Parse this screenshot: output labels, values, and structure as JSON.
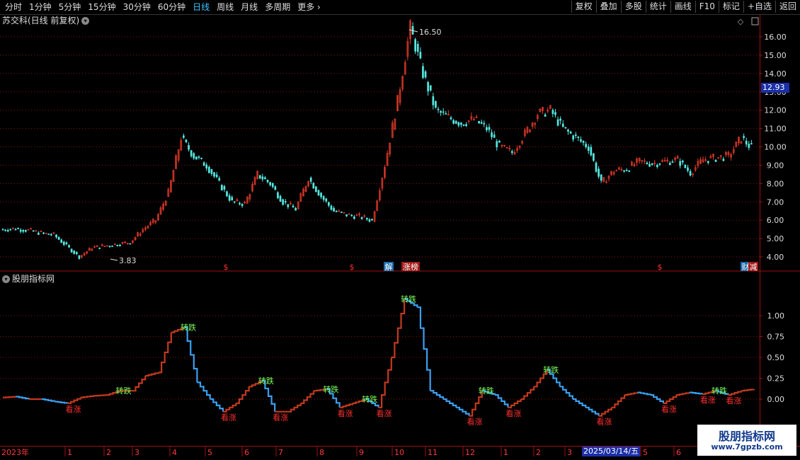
{
  "toolbar": {
    "periods": [
      "分时",
      "1分钟",
      "5分钟",
      "15分钟",
      "30分钟",
      "60分钟",
      "日线",
      "周线",
      "月线",
      "多周期",
      "更多"
    ],
    "active_period": "日线",
    "buttons": [
      "复权",
      "叠加",
      "多股",
      "统计",
      "画线",
      "F10",
      "标记",
      "+自选",
      "返回"
    ]
  },
  "main_chart": {
    "title": "苏交科(日线 前复权)",
    "y_ticks": [
      "16.00",
      "15.00",
      "14.00",
      "13.00",
      "12.00",
      "11.00",
      "10.00",
      "9.00",
      "8.00",
      "7.00",
      "6.00",
      "5.00",
      "4.00"
    ],
    "current_price": "12.93",
    "high_label": "16.50",
    "low_label": "3.83",
    "markers": [
      "$",
      "$",
      "解",
      "涨榜",
      "$",
      "财",
      "减"
    ]
  },
  "indicator": {
    "title": "股朋指标网",
    "y_ticks": [
      "1.00",
      "0.75",
      "0.50",
      "0.25",
      "0.00"
    ],
    "signal_down": "转跌",
    "signal_up": "看涨"
  },
  "time_axis": {
    "labels": [
      "2023年",
      "1",
      "2",
      "3",
      "4",
      "5",
      "6",
      "7",
      "8",
      "9",
      "10",
      "11",
      "12",
      "1",
      "2",
      "3",
      "5",
      "6"
    ],
    "date_tag": "2025/03/14/五"
  },
  "watermark": {
    "title": "股朋指标网",
    "url": "www.7gpzb.com"
  },
  "colors": {
    "up": "#e03a2a",
    "down": "#54e8e0",
    "rise_line": "#c23a1e",
    "fall_line": "#3aa0f0",
    "grid": "#8a1010",
    "signal_down_color": "#7dff5a",
    "signal_up_color": "#ff3030"
  },
  "chart_data": [
    {
      "type": "candlestick",
      "title": "苏交科(日线 前复权)",
      "ylim": [
        3.6,
        16.8
      ],
      "x": [
        "2023年",
        "1",
        "2",
        "3",
        "4",
        "5",
        "6",
        "7",
        "8",
        "9",
        "10",
        "11",
        "12",
        "1",
        "2",
        "3",
        "5",
        "6"
      ],
      "series": [
        {
          "values": [
            5.5,
            5.55,
            5.45,
            5.3,
            5.2,
            4.6,
            4.0,
            4.5,
            4.6,
            4.7,
            4.8,
            5.5,
            6.0,
            7.5,
            10.5,
            9.5,
            9.0,
            8.0,
            7.0,
            6.9,
            8.5,
            8.0,
            7.0,
            6.6,
            8.3,
            7.3,
            6.5,
            6.3,
            6.2,
            6.0,
            9.0,
            12.5,
            16.5,
            14.0,
            12.0,
            11.6,
            11.3,
            11.5,
            11.0,
            10.0,
            9.7,
            10.7,
            11.8,
            12.0,
            11.0,
            10.5,
            10.0,
            8.0,
            8.7,
            8.8,
            9.2,
            9.1,
            9.2,
            9.3,
            8.6,
            9.3,
            9.4,
            9.5,
            10.5,
            9.8
          ]
        }
      ]
    },
    {
      "type": "line",
      "title": "股朋指标网",
      "ylim": [
        -0.2,
        1.3
      ],
      "series": [
        {
          "values": [
            0.02,
            0.03,
            0.0,
            0.0,
            -0.03,
            -0.05,
            0.02,
            0.04,
            0.05,
            0.1,
            0.1,
            0.28,
            0.32,
            0.8,
            0.86,
            0.2,
            0.0,
            -0.15,
            -0.05,
            0.15,
            0.22,
            -0.15,
            -0.15,
            -0.05,
            0.1,
            0.12,
            -0.1,
            -0.05,
            0.0,
            -0.1,
            0.5,
            1.2,
            1.1,
            0.1,
            0.0,
            -0.1,
            -0.2,
            0.1,
            0.05,
            -0.1,
            0.0,
            0.15,
            0.35,
            0.15,
            0.0,
            -0.1,
            -0.2,
            -0.1,
            0.05,
            0.08,
            0.05,
            -0.05,
            0.05,
            0.08,
            0.06,
            0.1,
            0.05,
            0.1,
            0.12
          ]
        }
      ]
    }
  ]
}
